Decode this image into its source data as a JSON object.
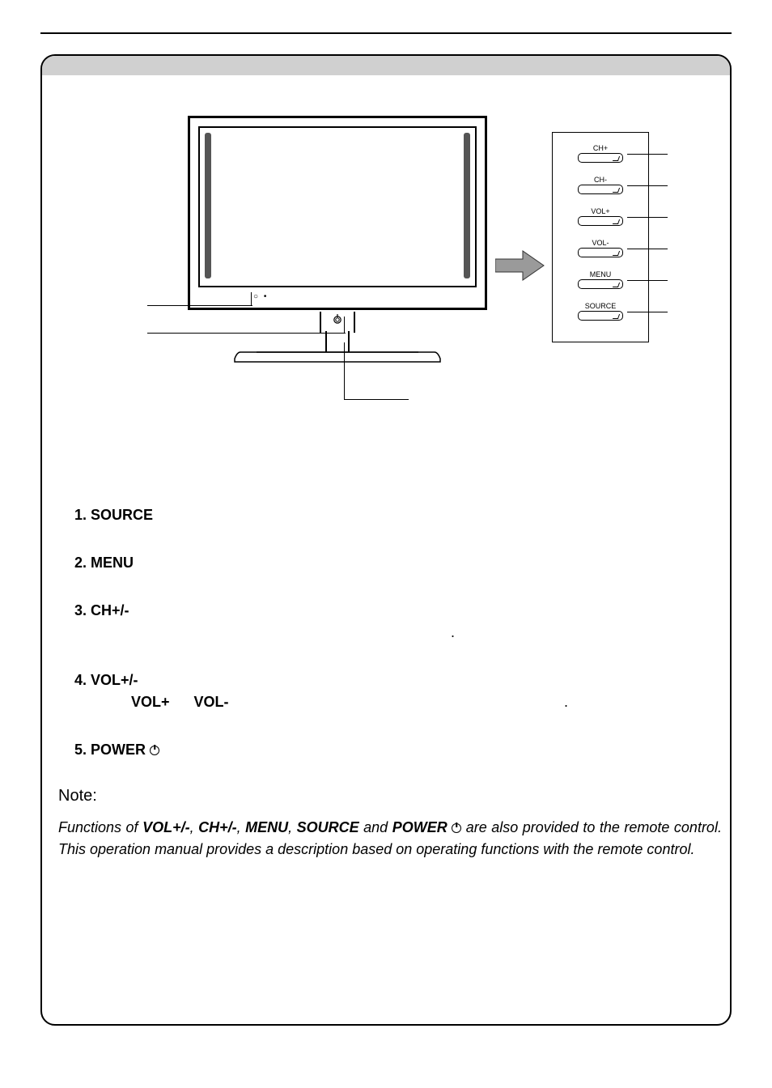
{
  "side_panel": {
    "btn1": "CH+",
    "btn2": "CH-",
    "btn3": "VOL+",
    "btn4": "VOL-",
    "btn5": "MENU",
    "btn6": "SOURCE"
  },
  "items": {
    "i1": {
      "hd": "1. SOURCE"
    },
    "i2": {
      "hd": "2. MENU"
    },
    "i3": {
      "hd": "3. CH+/-"
    },
    "i4": {
      "hd": "4. VOL+/-",
      "volp": "VOL+",
      "volm": "VOL-"
    },
    "i5": {
      "hd": "5. POWER"
    }
  },
  "note": {
    "title": "Note:",
    "pre": "Functions of ",
    "b1": "VOL+/-",
    "s1": ", ",
    "b2": "CH+/-",
    "s2": ", ",
    "b3": "MENU",
    "s3": ", ",
    "b4": "SOURCE",
    "s4": " and ",
    "b5": "POWER",
    "post": " are also provided to the remote control. This operation manual provides a description based on operating functions with the remote control."
  }
}
